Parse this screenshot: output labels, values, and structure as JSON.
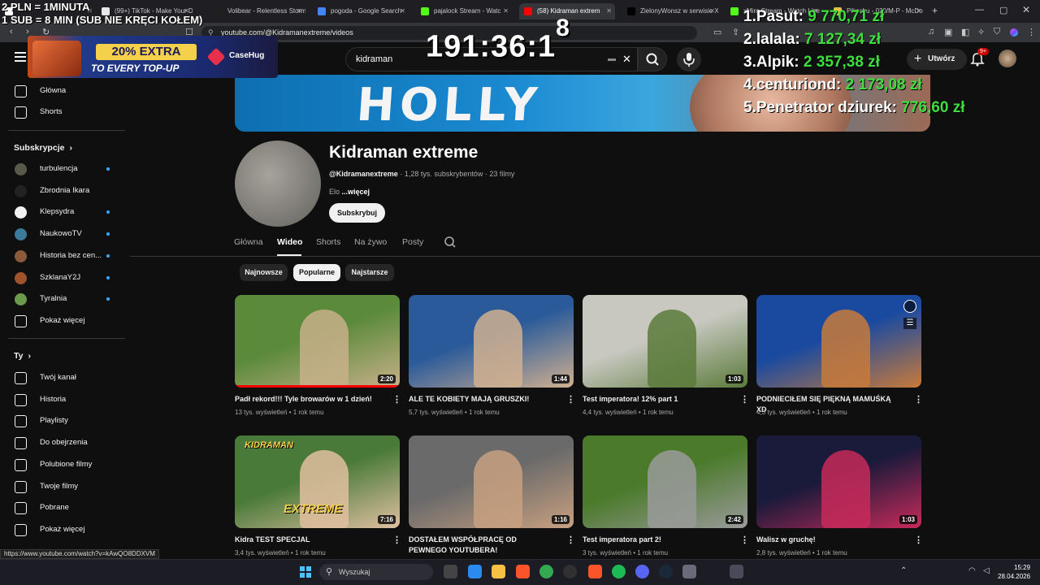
{
  "browser": {
    "tabs": [
      {
        "label": "",
        "color": "#fff"
      },
      {
        "label": "(99+) TikTok - Make Your D",
        "color": "#e6e6e6"
      },
      {
        "label": "Volibear - Relentless Storm",
        "color": "#1f1f1f"
      },
      {
        "label": "pogoda - Google Search",
        "color": "#4285f4"
      },
      {
        "label": "pajalock Stream - Watc",
        "color": "#53fc18"
      },
      {
        "label": "(58) Kidraman extrem",
        "color": "#ff0000"
      },
      {
        "label": "ZielonyWonsz w serwisie X",
        "color": "#000000"
      },
      {
        "label": "xMiro Stream - Watch Live",
        "color": "#53fc18"
      },
      {
        "label": "Pikachu - 020/M-P - McDo",
        "color": "#e6c04a"
      }
    ],
    "new_tab": "+",
    "url": "youtube.com/@Kidramanextreme/videos"
  },
  "overlay": {
    "rate_line1": "2 PLN = 1MINUTA",
    "rate_line2": "1 SUB = 8 MIN (SUB NIE KRĘCI KOŁEM)",
    "timer_main": "191:36:1",
    "timer_sup": "8",
    "leaderboard": [
      {
        "rank": "1.",
        "name": "Pasut:",
        "amount": "9 770,71 zł"
      },
      {
        "rank": "2.",
        "name": "lalala:",
        "amount": "7 127,34 zł"
      },
      {
        "rank": "3.",
        "name": "Alpik:",
        "amount": "2 357,38 zł"
      },
      {
        "rank": "4.",
        "name": "centuriond:",
        "amount": "2 173,08 zł"
      },
      {
        "rank": "5.",
        "name": "Penetrator dziurek:",
        "amount": "776,60 zł"
      }
    ],
    "promo_line1": "20% EXTRA",
    "promo_line2": "TO EVERY TOP-UP",
    "promo_brand": "CaseHug"
  },
  "header": {
    "search_value": "kidraman",
    "create_label": "Utwórz",
    "notif_count": "9+"
  },
  "sidebar": {
    "main": [
      {
        "label": "Główna",
        "icon": "home-icon"
      },
      {
        "label": "Shorts",
        "icon": "shorts-icon"
      }
    ],
    "subs_heading": "Subskrypcje",
    "subs": [
      {
        "label": "turbulencja",
        "color": "#5a5a4a",
        "dot": true
      },
      {
        "label": "Zbrodnia Ikara",
        "color": "#222222",
        "dot": false
      },
      {
        "label": "Klepsydra",
        "color": "#f1f1f1",
        "dot": true
      },
      {
        "label": "NaukowoTV",
        "color": "#3a7a9a",
        "dot": true
      },
      {
        "label": "Historia bez cen...",
        "color": "#8a5a3a",
        "dot": true
      },
      {
        "label": "SzklanaY2J",
        "color": "#a0522d",
        "dot": true
      },
      {
        "label": "Tyralnia",
        "color": "#6a9a4a",
        "dot": true
      }
    ],
    "subs_more": "Pokaż więcej",
    "you_heading": "Ty",
    "you": [
      {
        "label": "Twój kanał",
        "icon": "channel-icon"
      },
      {
        "label": "Historia",
        "icon": "history-icon"
      },
      {
        "label": "Playlisty",
        "icon": "playlist-icon"
      },
      {
        "label": "Do obejrzenia",
        "icon": "watch-later-icon"
      },
      {
        "label": "Polubione filmy",
        "icon": "like-icon"
      },
      {
        "label": "Twoje filmy",
        "icon": "your-videos-icon"
      },
      {
        "label": "Pobrane",
        "icon": "download-icon"
      },
      {
        "label": "Pokaż więcej",
        "icon": "chevron-down-icon"
      }
    ]
  },
  "channel": {
    "name": "Kidraman extreme",
    "handle": "@Kidramanextreme",
    "meta": " · 1,28 tys. subskrybentów · 23 filmy",
    "desc": "Elo",
    "desc_more": "...więcej",
    "subscribe": "Subskrybuj",
    "tabs": [
      "Główna",
      "Wideo",
      "Shorts",
      "Na żywo",
      "Posty"
    ],
    "chips": [
      "Najnowsze",
      "Popularne",
      "Najstarsze"
    ]
  },
  "videos": [
    {
      "title": "Padł rekord!!! Tyle browarów w 1 dzień!",
      "views": "13 tys. wyświetleń",
      "age": "1 rok temu",
      "duration": "2:20",
      "progress": 1.0,
      "palette": [
        "#5a8a3a",
        "#c8b08a"
      ]
    },
    {
      "title": "ALE TE KOBIETY MAJĄ GRUSZKI!",
      "views": "5,7 tys. wyświetleń",
      "age": "1 rok temu",
      "duration": "1:44",
      "progress": 0,
      "palette": [
        "#2a5a9a",
        "#d0b090"
      ]
    },
    {
      "title": "Test imperatora! 12% part 1",
      "views": "4,4 tys. wyświetleń",
      "age": "1 rok temu",
      "duration": "1:03",
      "progress": 0,
      "palette": [
        "#c8c8c0",
        "#5a7a3a"
      ]
    },
    {
      "title": "PODNIECIŁEM SIĘ PIĘKNĄ MAMUŚKĄ XD",
      "views": "4,3 tys. wyświetleń",
      "age": "1 rok temu",
      "duration": "",
      "progress": 0,
      "palette": [
        "#1a4aa0",
        "#c87a3a"
      ]
    },
    {
      "title": "Kidra TEST SPECJAL",
      "views": "3,4 tys. wyświetleń",
      "age": "1 rok temu",
      "duration": "7:16",
      "progress": 0,
      "palette": [
        "#4a7a3a",
        "#e0c0a0"
      ],
      "badge": "EXTREME",
      "badge_top": "KIDRAMAN"
    },
    {
      "title": "DOSTAŁEM WSPÓŁPRACĘ OD PEWNEGO YOUTUBERA!",
      "views": "",
      "age": "",
      "duration": "1:16",
      "progress": 0,
      "palette": [
        "#6a6a6a",
        "#c8a080"
      ]
    },
    {
      "title": "Test imperatora part 2!",
      "views": "3 tys. wyświetleń",
      "age": "1 rok temu",
      "duration": "2:42",
      "progress": 0,
      "palette": [
        "#4a7a2a",
        "#9a9a9a"
      ]
    },
    {
      "title": "Walisz w gruchę!",
      "views": "2,8 tys. wyświetleń",
      "age": "1 rok temu",
      "duration": "1:03",
      "progress": 0,
      "palette": [
        "#1a1a3a",
        "#c82a5a"
      ]
    }
  ],
  "status_url": "https://www.youtube.com/watch?v=kAwQO8DDXVM",
  "taskbar": {
    "search_placeholder": "Wyszukaj",
    "time": "15:29",
    "date": "28.04.2026"
  }
}
